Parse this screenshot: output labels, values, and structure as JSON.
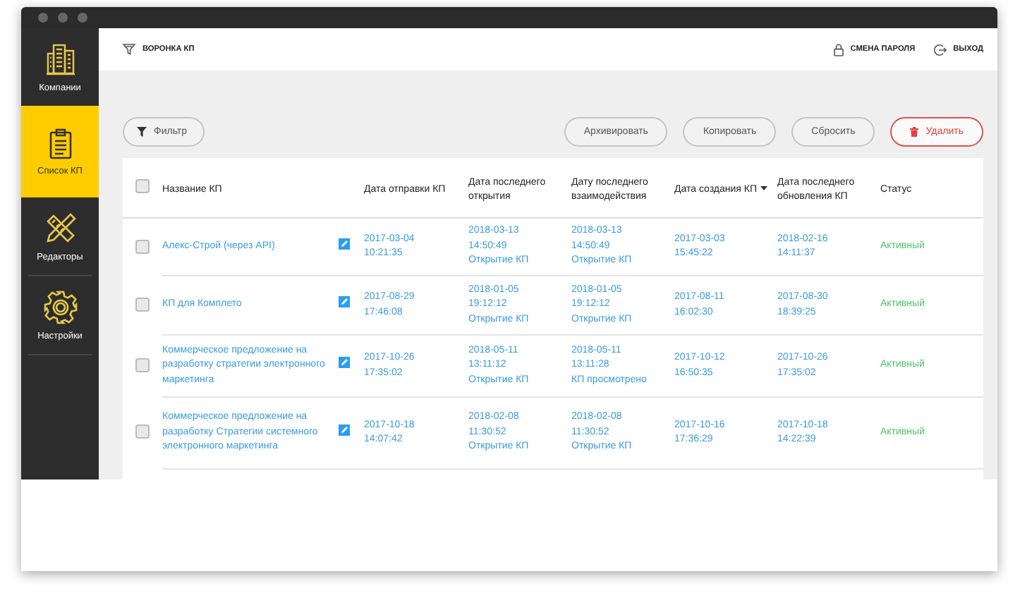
{
  "sidebar": {
    "items": [
      {
        "label": "Компании",
        "selected": false
      },
      {
        "label": "Список КП",
        "selected": true
      },
      {
        "label": "Редакторы",
        "selected": false
      },
      {
        "label": "Настройки",
        "selected": false
      }
    ]
  },
  "header": {
    "title": "ВОРОНКА КП",
    "links": [
      "СМЕНА ПАРОЛЯ",
      "ВЫХОД"
    ]
  },
  "toolbar": {
    "filter": "Фильтр",
    "actions": [
      {
        "label": "Архивировать",
        "kind": "normal"
      },
      {
        "label": "Копировать",
        "kind": "normal"
      },
      {
        "label": "Сбросить",
        "kind": "normal"
      },
      {
        "label": "Удалить",
        "kind": "danger"
      }
    ]
  },
  "table": {
    "select_all": {
      "checked": false
    },
    "columns": [
      {
        "label": "Название КП",
        "sorted": false
      },
      {
        "label": "Дата отправки КП",
        "sorted": false
      },
      {
        "label": "Дата последнего открытия",
        "sorted": false
      },
      {
        "label": "Дату последнего взаимодействия",
        "sorted": false
      },
      {
        "label": "Дата создания КП",
        "sorted": true
      },
      {
        "label": "Дата последнего обновления КП",
        "sorted": false
      },
      {
        "label": "Статус",
        "sorted": false
      }
    ],
    "rows": [
      {
        "checked": false,
        "name": "Алекс-Строй (через API)",
        "sent": "2017-03-04\n10:21:35",
        "opened": "2018-03-13\n14:50:49\nОткрытие КП",
        "interaction": "2018-03-13\n14:50:49\nОткрытие КП",
        "created": "2017-03-03\n15:45:22",
        "updated": "2018-02-16\n14:11:37",
        "status": "Активный"
      },
      {
        "checked": false,
        "name": "КП для Комплето",
        "sent": "2017-08-29\n17:46:08",
        "opened": "2018-01-05\n19:12:12\nОткрытие КП",
        "interaction": "2018-01-05\n19:12:12\nОткрытие КП",
        "created": "2017-08-11\n16:02:30",
        "updated": "2017-08-30\n18:39:25",
        "status": "Активный"
      },
      {
        "checked": false,
        "name": "Коммерческое предложение на разработку стратегии электронного маркетинга",
        "sent": "2017-10-26\n17:35:02",
        "opened": "2018-05-11\n13:11:12\nОткрытие КП",
        "interaction": "2018-05-11\n13:11:28\nКП просмотрено",
        "created": "2017-10-12\n16:50:35",
        "updated": "2017-10-26\n17:35:02",
        "status": "Активный"
      },
      {
        "checked": false,
        "name": "Коммерческое предложение на разработку Стратегии системного электронного маркетинга",
        "sent": "2017-10-18\n14:07:42",
        "opened": "2018-02-08\n11:30:52\nОткрытие КП",
        "interaction": "2018-02-08\n11:30:52\nОткрытие КП",
        "created": "2017-10-16\n17:36:29",
        "updated": "2017-10-18\n14:22:39",
        "status": "Активный"
      }
    ]
  }
}
